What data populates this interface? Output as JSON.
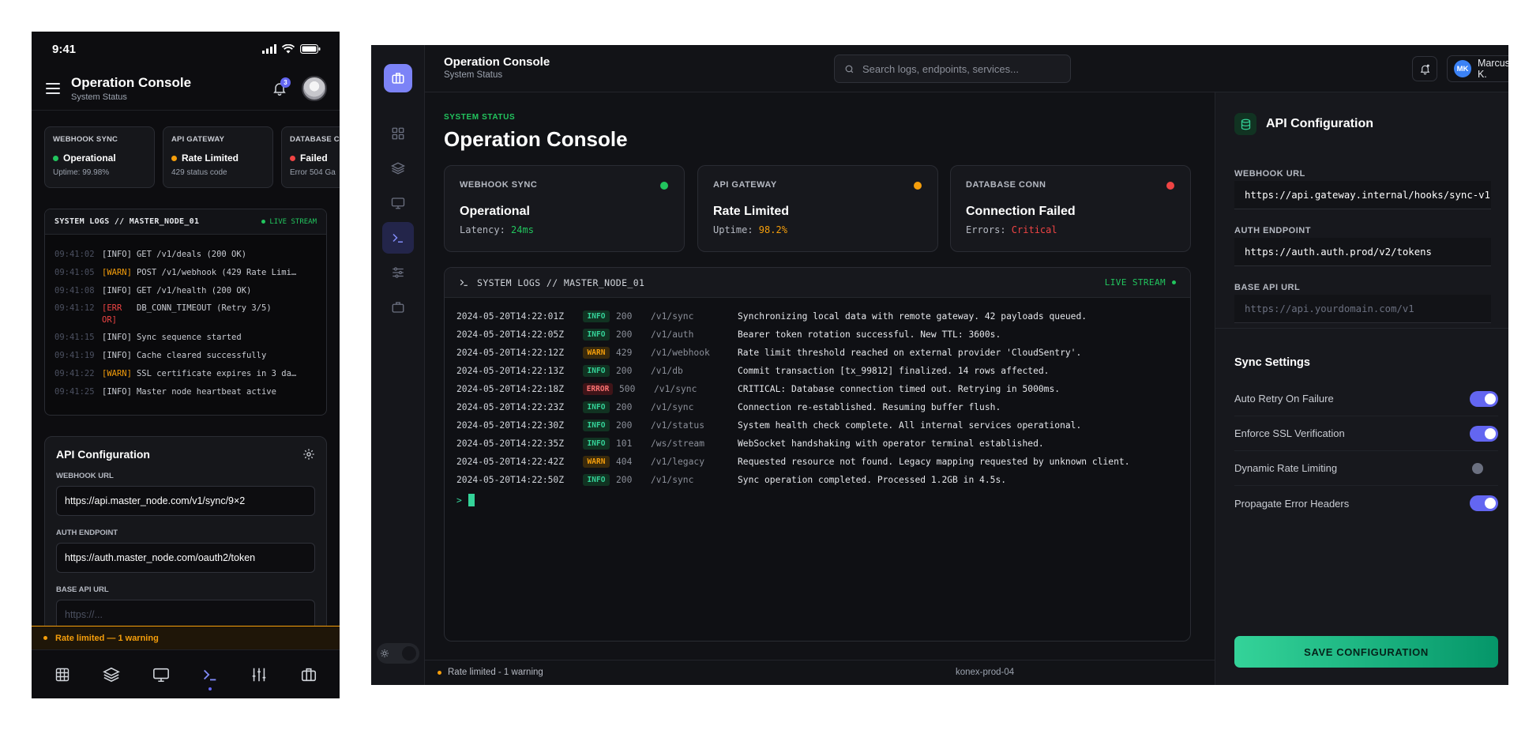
{
  "mobile": {
    "status_bar": {
      "time": "9:41"
    },
    "header": {
      "title": "Operation Console",
      "subtitle": "System Status",
      "notification_count": "3"
    },
    "cards": [
      {
        "label": "WEBHOOK SYNC",
        "value": "Operational",
        "sub": "Uptime: 99.98%",
        "color": "#22c55e"
      },
      {
        "label": "API GATEWAY",
        "value": "Rate Limited",
        "sub": "429 status code",
        "color": "#f59e0b"
      },
      {
        "label": "DATABASE C",
        "value": "Failed",
        "sub": "Error 504 Ga",
        "color": "#ef4444"
      }
    ],
    "logs": {
      "title": "SYSTEM LOGS // MASTER_NODE_01",
      "live": "LIVE STREAM",
      "lines": [
        {
          "time": "09:41:02",
          "level": "[INFO]",
          "msg": "GET /v1/deals (200 OK)"
        },
        {
          "time": "09:41:05",
          "level": "[WARN]",
          "msg": "POST /v1/webhook (429 Rate Limi…"
        },
        {
          "time": "09:41:08",
          "level": "[INFO]",
          "msg": "GET /v1/health (200 OK)"
        },
        {
          "time": "09:41:12",
          "level_a": "[ERR",
          "level_b": "OR]",
          "msg": "DB_CONN_TIMEOUT (Retry 3/5)"
        },
        {
          "time": "09:41:15",
          "level": "[INFO]",
          "msg": "Sync sequence started"
        },
        {
          "time": "09:41:19",
          "level": "[INFO]",
          "msg": "Cache cleared successfully"
        },
        {
          "time": "09:41:22",
          "level": "[WARN]",
          "msg": "SSL certificate expires in 3 da…"
        },
        {
          "time": "09:41:25",
          "level": "[INFO]",
          "msg": "Master node heartbeat active"
        }
      ]
    },
    "api": {
      "title": "API Configuration",
      "webhook_label": "WEBHOOK URL",
      "webhook_value": "https://api.master_node.com/v1/sync/9×2",
      "auth_label": "AUTH ENDPOINT",
      "auth_value": "https://auth.master_node.com/oauth2/token",
      "base_label": "BASE API URL",
      "base_placeholder": "https://..."
    },
    "banner": "Rate limited — 1 warning",
    "nav": [
      "grid-icon",
      "layers-icon",
      "monitor-icon",
      "terminal-icon",
      "sliders-icon",
      "briefcase-icon"
    ]
  },
  "desktop": {
    "topbar": {
      "title": "Operation Console",
      "subtitle": "System Status",
      "search_placeholder": "Search logs, endpoints, services...",
      "user_initials": "MK",
      "user_name": "Marcus K."
    },
    "eyebrow": "SYSTEM STATUS",
    "heading": "Operation Console",
    "cards": [
      {
        "label": "WEBHOOK SYNC",
        "value": "Operational",
        "sub_label": "Latency: ",
        "sub_value": "24ms",
        "color": "#22c55e"
      },
      {
        "label": "API GATEWAY",
        "value": "Rate Limited",
        "sub_label": "Uptime: ",
        "sub_value": "98.2%",
        "color": "#f59e0b"
      },
      {
        "label": "DATABASE CONN",
        "value": "Connection Failed",
        "sub_label": "Errors: ",
        "sub_value": "Critical",
        "color": "#ef4444"
      }
    ],
    "terminal": {
      "title": "SYSTEM LOGS // MASTER_NODE_01",
      "live": "LIVE STREAM",
      "prompt": ">",
      "rows": [
        {
          "ts": "2024-05-20T14:22:01Z",
          "level": "INFO",
          "code": "200",
          "ep": "/v1/sync",
          "msg": "Synchronizing local data with remote gateway. 42 payloads queued."
        },
        {
          "ts": "2024-05-20T14:22:05Z",
          "level": "INFO",
          "code": "200",
          "ep": "/v1/auth",
          "msg": "Bearer token rotation successful. New TTL: 3600s."
        },
        {
          "ts": "2024-05-20T14:22:12Z",
          "level": "WARN",
          "code": "429",
          "ep": "/v1/webhook",
          "msg": "Rate limit threshold reached on external provider 'CloudSentry'."
        },
        {
          "ts": "2024-05-20T14:22:13Z",
          "level": "INFO",
          "code": "200",
          "ep": "/v1/db",
          "msg": "Commit transaction [tx_99812] finalized. 14 rows affected."
        },
        {
          "ts": "2024-05-20T14:22:18Z",
          "level": "ERROR",
          "code": "500",
          "ep": "/v1/sync",
          "msg": "CRITICAL: Database connection timed out. Retrying in 5000ms."
        },
        {
          "ts": "2024-05-20T14:22:23Z",
          "level": "INFO",
          "code": "200",
          "ep": "/v1/sync",
          "msg": "Connection re-established. Resuming buffer flush."
        },
        {
          "ts": "2024-05-20T14:22:30Z",
          "level": "INFO",
          "code": "200",
          "ep": "/v1/status",
          "msg": "System health check complete. All internal services operational."
        },
        {
          "ts": "2024-05-20T14:22:35Z",
          "level": "INFO",
          "code": "101",
          "ep": "/ws/stream",
          "msg": "WebSocket handshaking with operator terminal established."
        },
        {
          "ts": "2024-05-20T14:22:42Z",
          "level": "WARN",
          "code": "404",
          "ep": "/v1/legacy",
          "msg": "Requested resource not found. Legacy mapping requested by unknown client."
        },
        {
          "ts": "2024-05-20T14:22:50Z",
          "level": "INFO",
          "code": "200",
          "ep": "/v1/sync",
          "msg": "Sync operation completed. Processed 1.2GB in 4.5s."
        }
      ]
    },
    "footer": {
      "status": "Rate limited - 1 warning",
      "host": "konex-prod-04"
    },
    "config": {
      "title": "API Configuration",
      "webhook_label": "WEBHOOK URL",
      "webhook_value": "https://api.gateway.internal/hooks/sync-v1",
      "auth_label": "AUTH ENDPOINT",
      "auth_value": "https://auth.auth.prod/v2/tokens",
      "base_label": "BASE API URL",
      "base_placeholder": "https://api.yourdomain.com/v1",
      "sync_title": "Sync Settings",
      "toggles": [
        {
          "label": "Auto Retry On Failure",
          "on": true
        },
        {
          "label": "Enforce SSL Verification",
          "on": true
        },
        {
          "label": "Dynamic Rate Limiting",
          "on": false
        },
        {
          "label": "Propagate Error Headers",
          "on": true
        }
      ],
      "save_label": "SAVE CONFIGURATION"
    }
  }
}
